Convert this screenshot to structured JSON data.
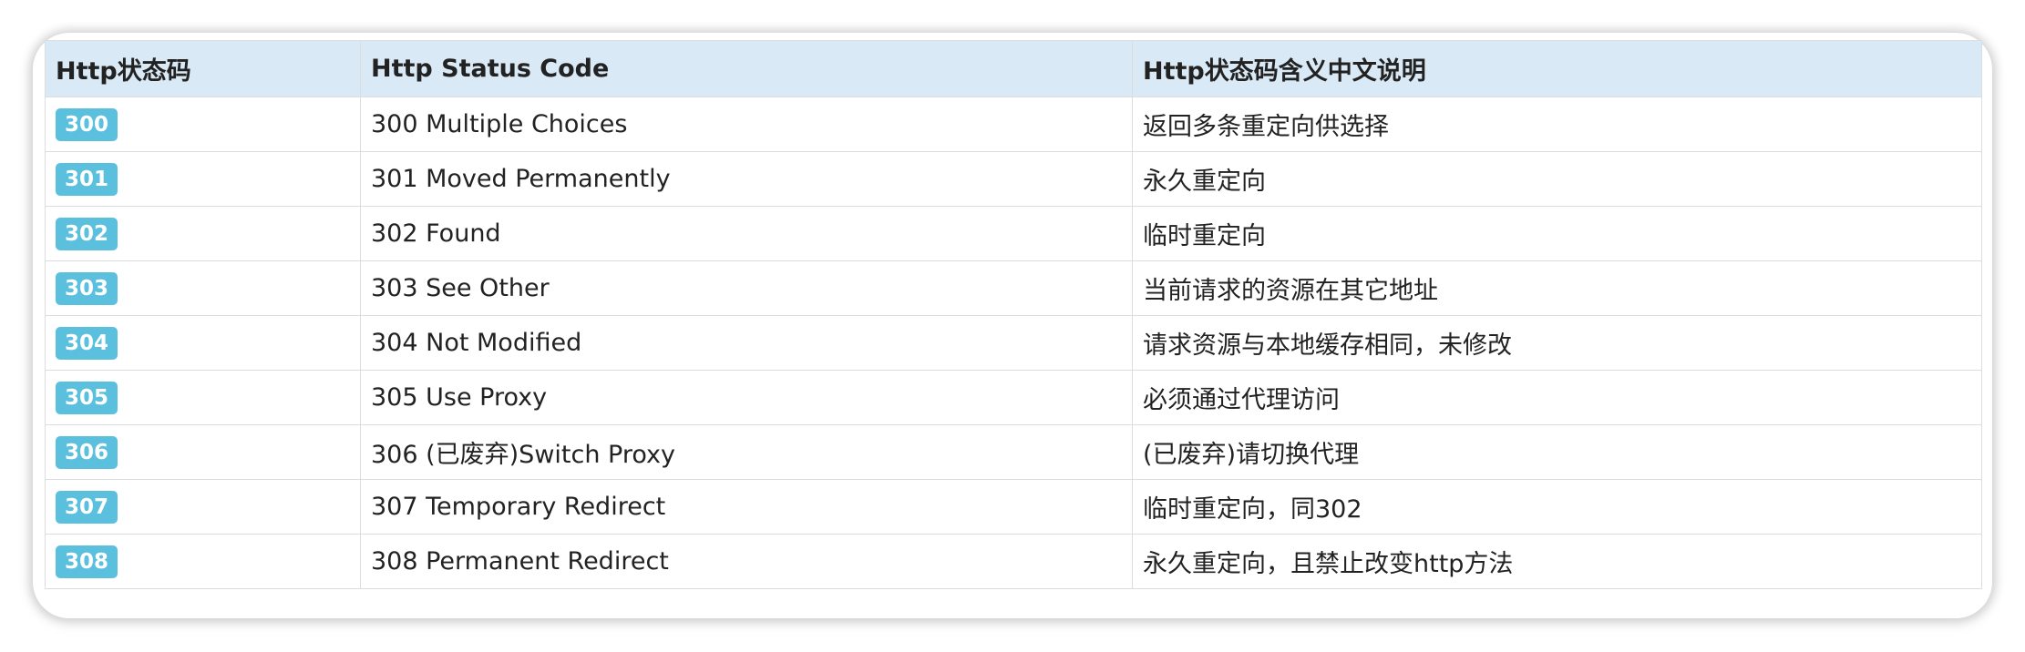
{
  "table": {
    "headers": [
      "Http状态码",
      "Http Status Code",
      "Http状态码含义中文说明"
    ],
    "rows": [
      {
        "code": "300",
        "name": "300 Multiple Choices",
        "desc": "返回多条重定向供选择"
      },
      {
        "code": "301",
        "name": "301 Moved Permanently",
        "desc": "永久重定向"
      },
      {
        "code": "302",
        "name": "302 Found",
        "desc": "临时重定向"
      },
      {
        "code": "303",
        "name": "303 See Other",
        "desc": "当前请求的资源在其它地址"
      },
      {
        "code": "304",
        "name": "304 Not Modified",
        "desc": "请求资源与本地缓存相同，未修改"
      },
      {
        "code": "305",
        "name": "305 Use Proxy",
        "desc": "必须通过代理访问"
      },
      {
        "code": "306",
        "name": "306 (已废弃)Switch Proxy",
        "desc": "(已废弃)请切换代理"
      },
      {
        "code": "307",
        "name": "307 Temporary Redirect",
        "desc": "临时重定向，同302"
      },
      {
        "code": "308",
        "name": "308 Permanent Redirect",
        "desc": "永久重定向，且禁止改变http方法"
      }
    ]
  },
  "colors": {
    "header_bg": "#d9eaf6",
    "badge_bg": "#5bc0de",
    "border": "#dddddd",
    "text": "#222222"
  }
}
